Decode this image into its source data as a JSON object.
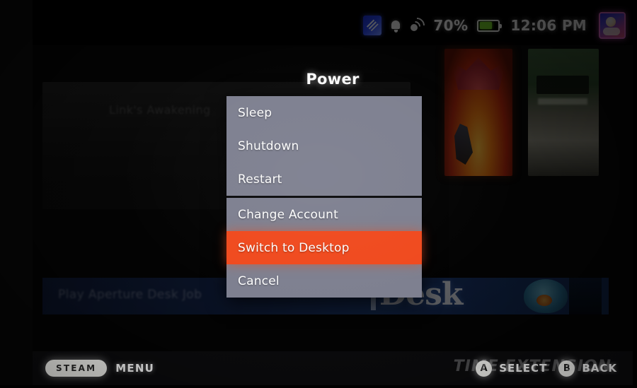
{
  "status_bar": {
    "download_icon": "download-badge-icon",
    "notification_icon": "bell-icon",
    "network_icon": "wifi-icon",
    "battery_percent": "70%",
    "battery_level": 70,
    "battery_color": "#76d32a",
    "clock": "12:06 PM",
    "avatar": "user-avatar"
  },
  "background": {
    "hero_title": "Link's Awakening",
    "banner_label": "Play Aperture Desk Job",
    "banner_wordmark": "Desk",
    "tiles": [
      {
        "name": "game-tile-red"
      },
      {
        "name": "game-tile-green"
      }
    ]
  },
  "overlay": {
    "title": "Power",
    "accent_color": "#f04a1e",
    "panel_color": "#7e8090",
    "groups": [
      {
        "items": [
          {
            "label": "Sleep",
            "selected": false
          },
          {
            "label": "Shutdown",
            "selected": false
          },
          {
            "label": "Restart",
            "selected": false
          }
        ]
      },
      {
        "items": [
          {
            "label": "Change Account",
            "selected": false
          },
          {
            "label": "Switch to Desktop",
            "selected": true
          },
          {
            "label": "Cancel",
            "selected": false
          }
        ]
      }
    ]
  },
  "action_bar": {
    "steam_button": "STEAM",
    "menu_label": "MENU",
    "hints": [
      {
        "button": "A",
        "label": "SELECT"
      },
      {
        "button": "B",
        "label": "BACK"
      }
    ],
    "watermark": "TIME EXTENSION"
  }
}
